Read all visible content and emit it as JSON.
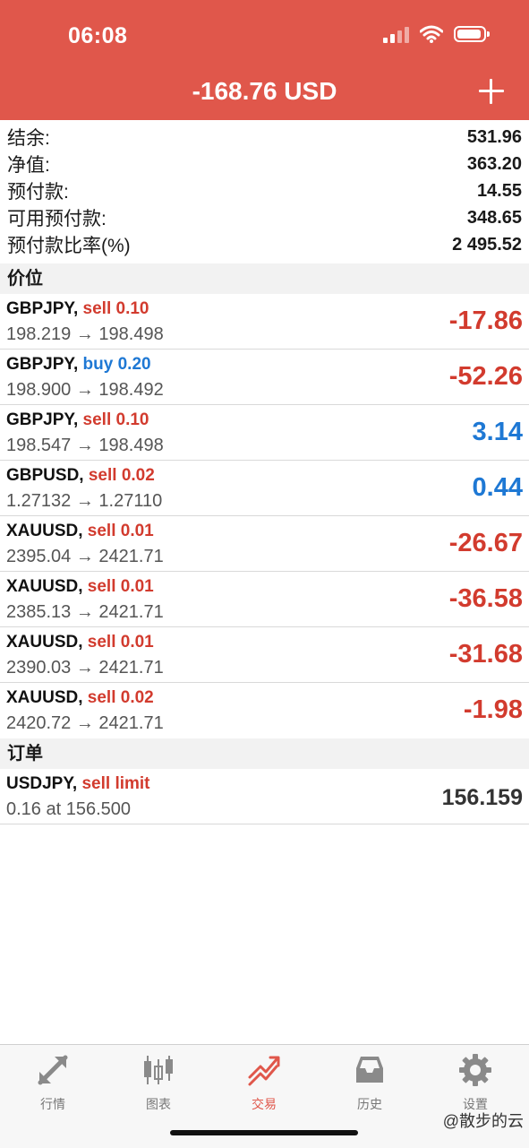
{
  "status": {
    "time": "06:08"
  },
  "header": {
    "title": "-168.76 USD"
  },
  "summary": [
    {
      "label": "结余:",
      "value": "531.96"
    },
    {
      "label": "净值:",
      "value": "363.20"
    },
    {
      "label": "预付款:",
      "value": "14.55"
    },
    {
      "label": "可用预付款:",
      "value": "348.65"
    },
    {
      "label": "预付款比率(%)",
      "value": "2 495.52"
    }
  ],
  "positions_header": "价位",
  "positions": [
    {
      "symbol": "GBPJPY,",
      "type": "sell 0.10",
      "prices": "198.219 → 198.498",
      "profit": "-17.86"
    },
    {
      "symbol": "GBPJPY,",
      "type": "buy 0.20",
      "prices": "198.900 → 198.492",
      "profit": "-52.26"
    },
    {
      "symbol": "GBPJPY,",
      "type": "sell 0.10",
      "prices": "198.547 → 198.498",
      "profit": "3.14"
    },
    {
      "symbol": "GBPUSD,",
      "type": "sell 0.02",
      "prices": "1.27132 → 1.27110",
      "profit": "0.44"
    },
    {
      "symbol": "XAUUSD,",
      "type": "sell 0.01",
      "prices": "2395.04 → 2421.71",
      "profit": "-26.67"
    },
    {
      "symbol": "XAUUSD,",
      "type": "sell 0.01",
      "prices": "2385.13 → 2421.71",
      "profit": "-36.58"
    },
    {
      "symbol": "XAUUSD,",
      "type": "sell 0.01",
      "prices": "2390.03 → 2421.71",
      "profit": "-31.68"
    },
    {
      "symbol": "XAUUSD,",
      "type": "sell 0.02",
      "prices": "2420.72 → 2421.71",
      "profit": "-1.98"
    }
  ],
  "orders_header": "订单",
  "orders": [
    {
      "symbol": "USDJPY,",
      "type": "sell limit",
      "prices": "0.16 at 156.500",
      "price": "156.159"
    }
  ],
  "tabs": [
    {
      "label": "行情",
      "icon": "quotes-icon"
    },
    {
      "label": "图表",
      "icon": "chart-icon"
    },
    {
      "label": "交易",
      "icon": "trade-icon",
      "active": true
    },
    {
      "label": "历史",
      "icon": "history-icon"
    },
    {
      "label": "设置",
      "icon": "settings-icon"
    }
  ],
  "watermark": "@散步的云",
  "colors": {
    "header": "#e0574b",
    "sell": "#d23b2e",
    "buy": "#1e78d4"
  }
}
